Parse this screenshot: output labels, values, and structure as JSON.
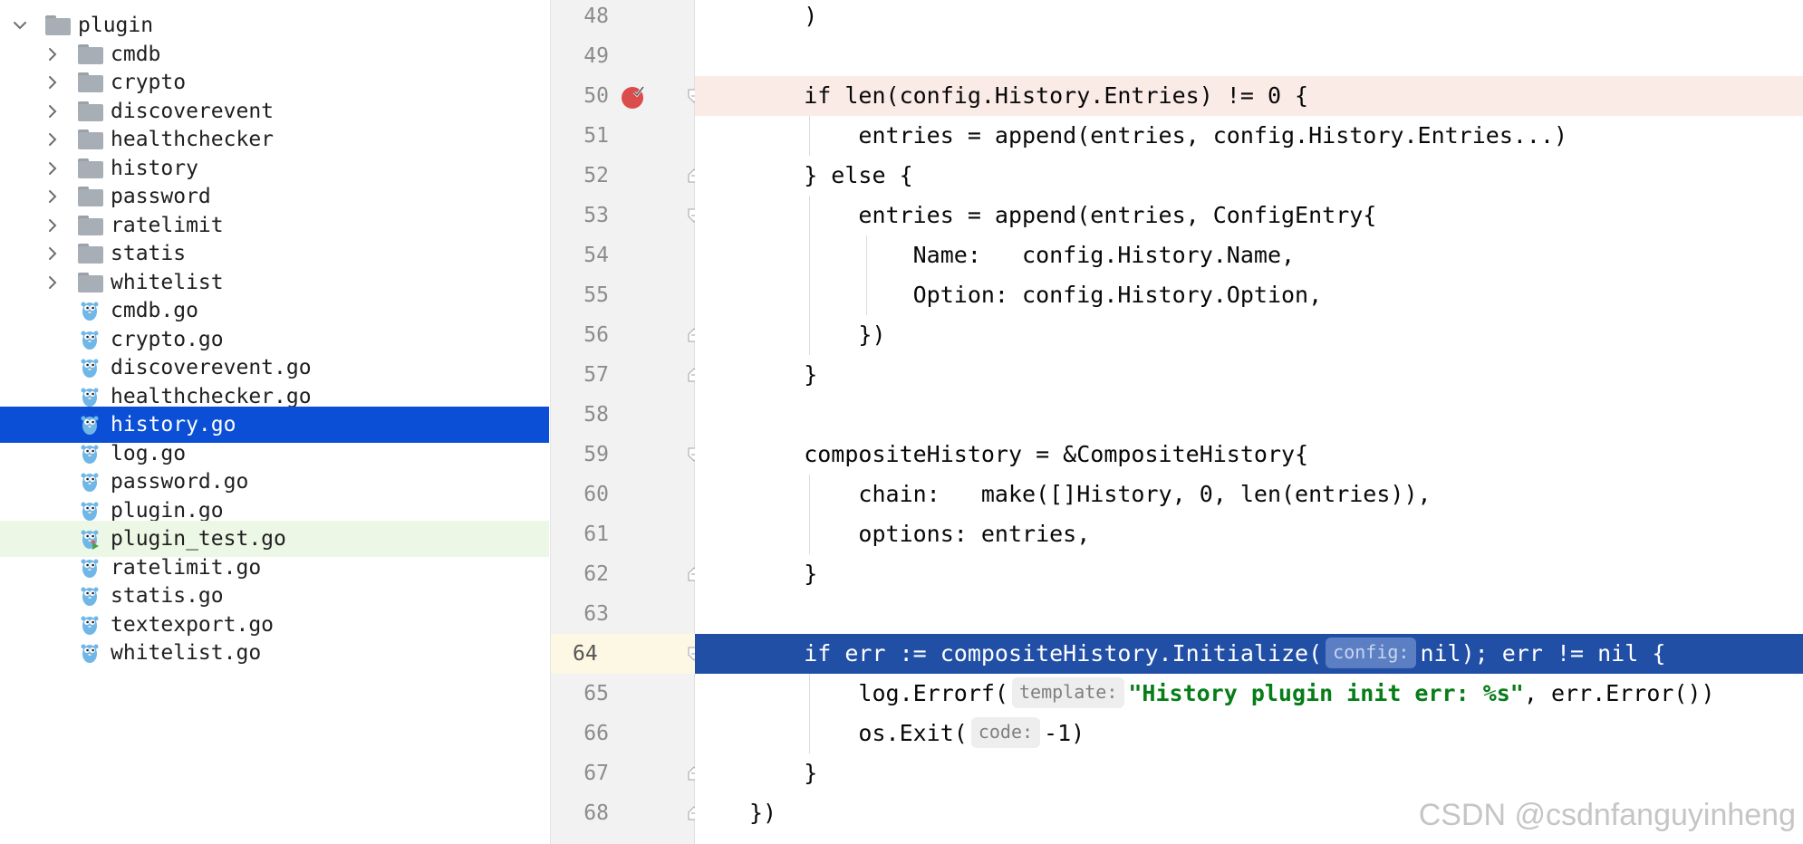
{
  "tree": {
    "root_folder": "plugin",
    "folders": [
      "cmdb",
      "crypto",
      "discoverevent",
      "healthchecker",
      "history",
      "password",
      "ratelimit",
      "statis",
      "whitelist"
    ],
    "files": [
      "cmdb.go",
      "crypto.go",
      "discoverevent.go",
      "healthchecker.go",
      "history.go",
      "log.go",
      "password.go",
      "plugin.go",
      "plugin_test.go",
      "ratelimit.go",
      "statis.go",
      "textexport.go",
      "whitelist.go"
    ],
    "selected_file": "history.go",
    "test_file": "plugin_test.go"
  },
  "editor": {
    "lines": [
      {
        "n": "48",
        "code": "    )"
      },
      {
        "n": "49",
        "code": ""
      },
      {
        "n": "50",
        "code": "    if len(config.History.Entries) != 0 {"
      },
      {
        "n": "51",
        "code": "        entries = append(entries, config.History.Entries...)"
      },
      {
        "n": "52",
        "code": "    } else {"
      },
      {
        "n": "53",
        "code": "        entries = append(entries, ConfigEntry{"
      },
      {
        "n": "54",
        "code": "            Name:   config.History.Name,"
      },
      {
        "n": "55",
        "code": "            Option: config.History.Option,"
      },
      {
        "n": "56",
        "code": "        })"
      },
      {
        "n": "57",
        "code": "    }"
      },
      {
        "n": "58",
        "code": ""
      },
      {
        "n": "59",
        "code": "    compositeHistory = &CompositeHistory{"
      },
      {
        "n": "60",
        "code": "        chain:   make([]History, 0, len(entries)),"
      },
      {
        "n": "61",
        "code": "        options: entries,"
      },
      {
        "n": "62",
        "code": "    }"
      },
      {
        "n": "63",
        "code": ""
      },
      {
        "n": "64",
        "code": "    if err := compositeHistory.Initialize(config: nil); err != nil {"
      },
      {
        "n": "65",
        "code": "        log.Errorf(template: \"History plugin init err: %s\", err.Error())"
      },
      {
        "n": "66",
        "code": "        os.Exit(code: -1)"
      },
      {
        "n": "67",
        "code": "    }"
      },
      {
        "n": "68",
        "code": "})"
      }
    ],
    "breakpoint_line": "50",
    "execution_line": "64",
    "inlay_hints": {
      "config": "config:",
      "template": "template:",
      "code": "code:"
    }
  },
  "watermark": "CSDN @csdnfanguyinheng",
  "colors": {
    "selection": "#0b4fd6",
    "execution_line": "#214fa6",
    "breakpoint_line": "#faebe7",
    "breakpoint": "#db4c4c",
    "keyword": "#0033b3",
    "number": "#1750eb",
    "string": "#067d17"
  }
}
